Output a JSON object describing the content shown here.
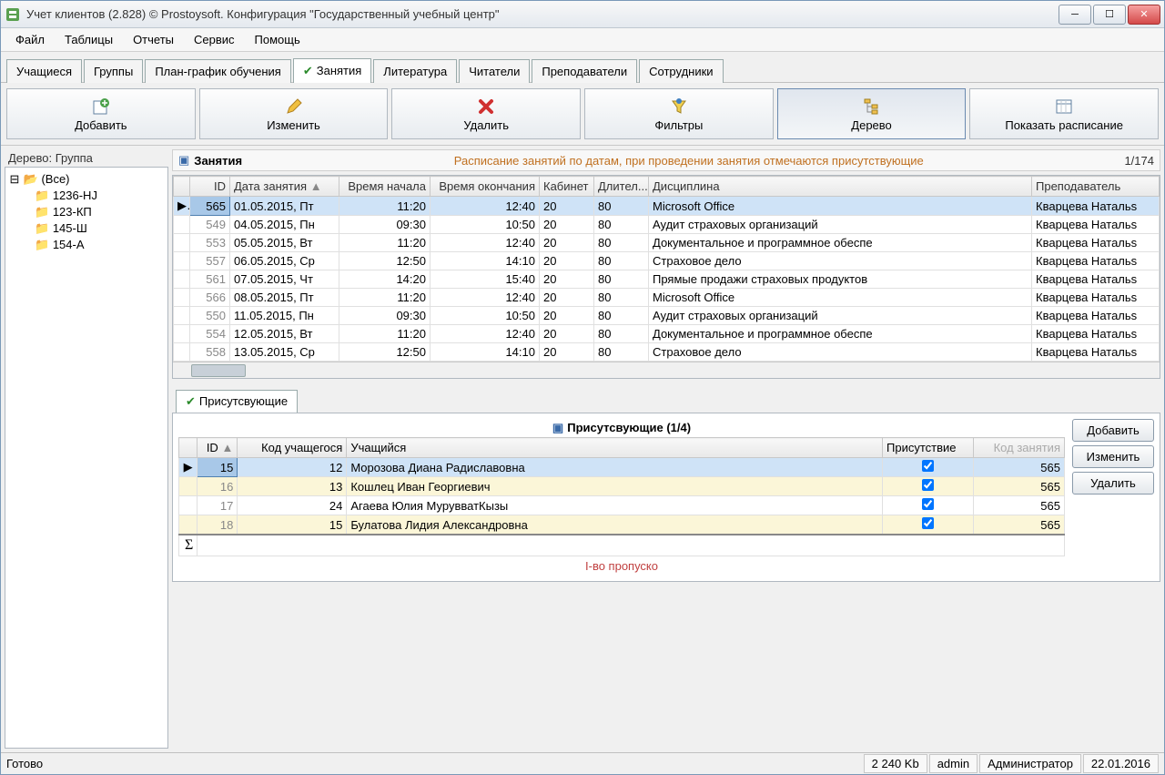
{
  "window": {
    "title": "Учет клиентов (2.828) © Prostoysoft. Конфигурация \"Государственный учебный центр\""
  },
  "menu": [
    "Файл",
    "Таблицы",
    "Отчеты",
    "Сервис",
    "Помощь"
  ],
  "tabs": [
    {
      "label": "Учащиеся",
      "active": false
    },
    {
      "label": "Группы",
      "active": false
    },
    {
      "label": "План-график обучения",
      "active": false
    },
    {
      "label": "Занятия",
      "active": true,
      "checked": true
    },
    {
      "label": "Литература",
      "active": false
    },
    {
      "label": "Читатели",
      "active": false
    },
    {
      "label": "Преподаватели",
      "active": false
    },
    {
      "label": "Сотрудники",
      "active": false
    }
  ],
  "toolbar": [
    {
      "label": "Добавить",
      "icon": "add-icon"
    },
    {
      "label": "Изменить",
      "icon": "edit-icon"
    },
    {
      "label": "Удалить",
      "icon": "delete-icon"
    },
    {
      "label": "Фильтры",
      "icon": "filter-icon"
    },
    {
      "label": "Дерево",
      "icon": "tree-icon",
      "pressed": true
    },
    {
      "label": "Показать расписание",
      "icon": "schedule-icon"
    }
  ],
  "tree": {
    "title": "Дерево: Группа",
    "root": "(Все)",
    "items": [
      "1236-HJ",
      "123-КП",
      "145-Ш",
      "154-А"
    ]
  },
  "section": {
    "title": "Занятия",
    "desc": "Расписание занятий по датам, при проведении занятия отмечаются присутствующие",
    "counter": "1/174"
  },
  "columns": [
    "",
    "ID",
    "Дата занятия",
    "Время начала",
    "Время окончания",
    "Кабинет",
    "Длител...",
    "Дисциплина",
    "Преподаватель"
  ],
  "rows": [
    {
      "sel": true,
      "id": "565",
      "date": "01.05.2015, Пт",
      "start": "11:20",
      "end": "12:40",
      "room": "20",
      "dur": "80",
      "disc": "Microsoft Office",
      "teacher": "Кварцева Натальѕ"
    },
    {
      "id": "549",
      "date": "04.05.2015, Пн",
      "start": "09:30",
      "end": "10:50",
      "room": "20",
      "dur": "80",
      "disc": "Аудит страховых организаций",
      "teacher": "Кварцева Натальѕ"
    },
    {
      "id": "553",
      "date": "05.05.2015, Вт",
      "start": "11:20",
      "end": "12:40",
      "room": "20",
      "dur": "80",
      "disc": "Документальное и программное обеспе",
      "teacher": "Кварцева Натальѕ"
    },
    {
      "id": "557",
      "date": "06.05.2015, Ср",
      "start": "12:50",
      "end": "14:10",
      "room": "20",
      "dur": "80",
      "disc": "Страховое дело",
      "teacher": "Кварцева Натальѕ"
    },
    {
      "id": "561",
      "date": "07.05.2015, Чт",
      "start": "14:20",
      "end": "15:40",
      "room": "20",
      "dur": "80",
      "disc": "Прямые продажи страховых продуктов",
      "teacher": "Кварцева Натальѕ"
    },
    {
      "id": "566",
      "date": "08.05.2015, Пт",
      "start": "11:20",
      "end": "12:40",
      "room": "20",
      "dur": "80",
      "disc": "Microsoft Office",
      "teacher": "Кварцева Натальѕ"
    },
    {
      "id": "550",
      "date": "11.05.2015, Пн",
      "start": "09:30",
      "end": "10:50",
      "room": "20",
      "dur": "80",
      "disc": "Аудит страховых организаций",
      "teacher": "Кварцева Натальѕ"
    },
    {
      "id": "554",
      "date": "12.05.2015, Вт",
      "start": "11:20",
      "end": "12:40",
      "room": "20",
      "dur": "80",
      "disc": "Документальное и программное обеспе",
      "teacher": "Кварцева Натальѕ"
    },
    {
      "id": "558",
      "date": "13.05.2015, Ср",
      "start": "12:50",
      "end": "14:10",
      "room": "20",
      "dur": "80",
      "disc": "Страховое дело",
      "teacher": "Кварцева Натальѕ"
    }
  ],
  "subtab": {
    "label": "Присутсвующие",
    "checked": true
  },
  "sub_header": "Присутсвующие (1/4)",
  "sub_columns": [
    "",
    "ID",
    "Код учащегося",
    "Учащийся",
    "Присутствие",
    "Код занятия"
  ],
  "sub_rows": [
    {
      "sel": true,
      "id": "15",
      "code": "12",
      "name": "Морозова Диана Радиславовна",
      "present": true,
      "lesson": "565"
    },
    {
      "alt": true,
      "id": "16",
      "code": "13",
      "name": "Кошлец Иван Георгиевич",
      "present": true,
      "lesson": "565"
    },
    {
      "id": "17",
      "code": "24",
      "name": "Агаева Юлия МурувватКызы",
      "present": true,
      "lesson": "565"
    },
    {
      "alt": true,
      "id": "18",
      "code": "15",
      "name": "Булатова Лидия Александровна",
      "present": true,
      "lesson": "565"
    }
  ],
  "sub_buttons": [
    "Добавить",
    "Изменить",
    "Удалить"
  ],
  "footer_note": "I-во пропуско",
  "status": {
    "ready": "Готово",
    "mem": "2 240 Kb",
    "user": "admin",
    "role": "Администратор",
    "date": "22.01.2016"
  }
}
